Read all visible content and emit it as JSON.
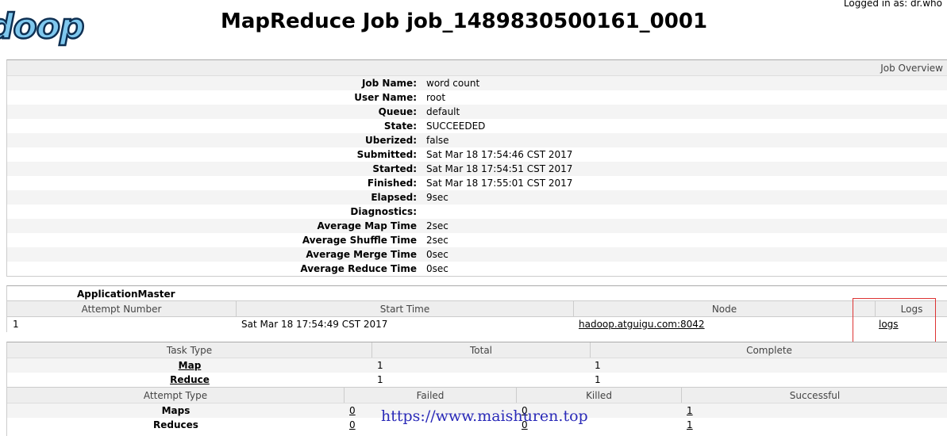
{
  "header": {
    "logo_text": "doop",
    "title": "MapReduce Job job_1489830500161_0001",
    "logged_in": "Logged in as: dr.who"
  },
  "job_overview": {
    "heading": "Job Overview",
    "rows": [
      {
        "label": "Job Name:",
        "value": "word count"
      },
      {
        "label": "User Name:",
        "value": "root"
      },
      {
        "label": "Queue:",
        "value": "default"
      },
      {
        "label": "State:",
        "value": "SUCCEEDED"
      },
      {
        "label": "Uberized:",
        "value": "false"
      },
      {
        "label": "Submitted:",
        "value": "Sat Mar 18 17:54:46 CST 2017"
      },
      {
        "label": "Started:",
        "value": "Sat Mar 18 17:54:51 CST 2017"
      },
      {
        "label": "Finished:",
        "value": "Sat Mar 18 17:55:01 CST 2017"
      },
      {
        "label": "Elapsed:",
        "value": "9sec"
      },
      {
        "label": "Diagnostics:",
        "value": ""
      },
      {
        "label": "Average Map Time",
        "value": "2sec"
      },
      {
        "label": "Average Shuffle Time",
        "value": "2sec"
      },
      {
        "label": "Average Merge Time",
        "value": "0sec"
      },
      {
        "label": "Average Reduce Time",
        "value": "0sec"
      }
    ]
  },
  "application_master": {
    "caption": "ApplicationMaster",
    "columns": [
      "Attempt Number",
      "Start Time",
      "Node",
      "Logs"
    ],
    "row": {
      "attempt": "1",
      "start_time": "Sat Mar 18 17:54:49 CST 2017",
      "node": "hadoop.atguigu.com:8042",
      "logs": "logs"
    }
  },
  "tasks": {
    "columns": [
      "Task Type",
      "Total",
      "Complete"
    ],
    "rows": [
      {
        "type": "Map",
        "total": "1",
        "complete": "1"
      },
      {
        "type": "Reduce",
        "total": "1",
        "complete": "1"
      }
    ]
  },
  "attempts": {
    "columns": [
      "Attempt Type",
      "Failed",
      "Killed",
      "Successful"
    ],
    "rows": [
      {
        "type": "Maps",
        "failed": "0",
        "killed": "0",
        "successful": "1"
      },
      {
        "type": "Reduces",
        "failed": "0",
        "killed": "0",
        "successful": "1"
      }
    ]
  },
  "watermark": "https://www.maishuren.top"
}
